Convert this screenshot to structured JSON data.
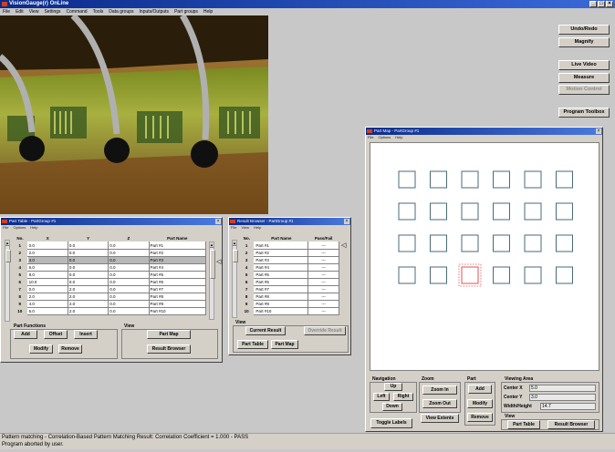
{
  "window": {
    "title": "VisionGauge(r) OnLine"
  },
  "menu": [
    "File",
    "Edit",
    "View",
    "Settings",
    "Command",
    "Tools",
    "Data groups",
    "Inputs/Outputs",
    "Part groups",
    "Help"
  ],
  "right_buttons": {
    "undo_redo": "Undo/Redo",
    "magnify": "Magnify",
    "live_video": "Live Video",
    "measure": "Measure",
    "motion_control": "Motion Control",
    "program_toolbox": "Program Toolbox"
  },
  "part_table": {
    "title": "Part Table - PartGroup #1",
    "menu": [
      "File",
      "Options",
      "Help"
    ],
    "columns": [
      "No.",
      "X",
      "Y",
      "Z",
      "Part Name"
    ],
    "rows": [
      {
        "no": "1",
        "x": "0.0",
        "y": "0.0",
        "z": "0.0",
        "name": "Part #1"
      },
      {
        "no": "2",
        "x": "2.0",
        "y": "0.0",
        "z": "0.0",
        "name": "Part #2"
      },
      {
        "no": "3",
        "x": "4.0",
        "y": "0.0",
        "z": "0.0",
        "name": "Part #3"
      },
      {
        "no": "4",
        "x": "6.0",
        "y": "0.0",
        "z": "0.0",
        "name": "Part #4"
      },
      {
        "no": "5",
        "x": "8.0",
        "y": "0.0",
        "z": "0.0",
        "name": "Part #5"
      },
      {
        "no": "6",
        "x": "10.0",
        "y": "0.0",
        "z": "0.0",
        "name": "Part #6"
      },
      {
        "no": "7",
        "x": "0.0",
        "y": "2.0",
        "z": "0.0",
        "name": "Part #7"
      },
      {
        "no": "8",
        "x": "2.0",
        "y": "2.0",
        "z": "0.0",
        "name": "Part #8"
      },
      {
        "no": "9",
        "x": "4.0",
        "y": "2.0",
        "z": "0.0",
        "name": "Part #9"
      },
      {
        "no": "10",
        "x": "6.0",
        "y": "2.0",
        "z": "0.0",
        "name": "Part #10"
      }
    ],
    "part_functions_label": "Part Functions",
    "view_label": "View",
    "add": "Add",
    "offset": "Offset",
    "insert": "Insert",
    "modify": "Modify",
    "remove": "Remove",
    "part_map": "Part Map",
    "result_browser": "Result Browser"
  },
  "result_browser": {
    "title": "Result Browser - PartGroup #1",
    "menu": [
      "File",
      "View",
      "Help"
    ],
    "columns": [
      "No.",
      "Part Name",
      "Pass/Fail"
    ],
    "rows": [
      {
        "no": "1",
        "name": "Part #1",
        "pf": "---"
      },
      {
        "no": "2",
        "name": "Part #2",
        "pf": "---"
      },
      {
        "no": "3",
        "name": "Part #3",
        "pf": "---"
      },
      {
        "no": "4",
        "name": "Part #4",
        "pf": "---"
      },
      {
        "no": "5",
        "name": "Part #5",
        "pf": "---"
      },
      {
        "no": "6",
        "name": "Part #6",
        "pf": "---"
      },
      {
        "no": "7",
        "name": "Part #7",
        "pf": "---"
      },
      {
        "no": "8",
        "name": "Part #8",
        "pf": "---"
      },
      {
        "no": "9",
        "name": "Part #9",
        "pf": "---"
      },
      {
        "no": "10",
        "name": "Part #10",
        "pf": "---"
      }
    ],
    "view_label": "View",
    "current_result": "Current Result",
    "override_result": "Override Result",
    "part_table": "Part Table",
    "part_map": "Part Map"
  },
  "part_map": {
    "title": "Part Map - PartGroup #1",
    "menu": [
      "File",
      "Options",
      "Help"
    ],
    "navigation": {
      "label": "Navigation",
      "up": "Up",
      "left": "Left",
      "right": "Right",
      "down": "Down"
    },
    "zoom": {
      "label": "Zoom",
      "zoom_in": "Zoom In",
      "zoom_out": "Zoom Out"
    },
    "part": {
      "label": "Part",
      "add": "Add",
      "modify": "Modify",
      "remove": "Remove"
    },
    "viewing_area": {
      "label": "Viewing Area",
      "center_x_label": "Center X",
      "center_x": "5.0",
      "center_y_label": "Center Y",
      "center_y": "3.0",
      "width_height_label": "Width/Height",
      "width_height": "14.7"
    },
    "toggle_labels": "Toggle Labels",
    "view_extents": "View Extents",
    "view_label": "View",
    "part_table": "Part Table",
    "result_browser": "Result Browser",
    "grid": {
      "rows": 4,
      "cols": 6,
      "highlighted": [
        3,
        2
      ]
    },
    "colors": {
      "part": "#4a6a7a",
      "highlight": "#e05050"
    }
  },
  "status": {
    "line1": "Pattern matching - Correlation-Based Pattern Matching Result: Correlation Coefficient = 1.000 - PASS",
    "line2": "Program aborted by user."
  }
}
